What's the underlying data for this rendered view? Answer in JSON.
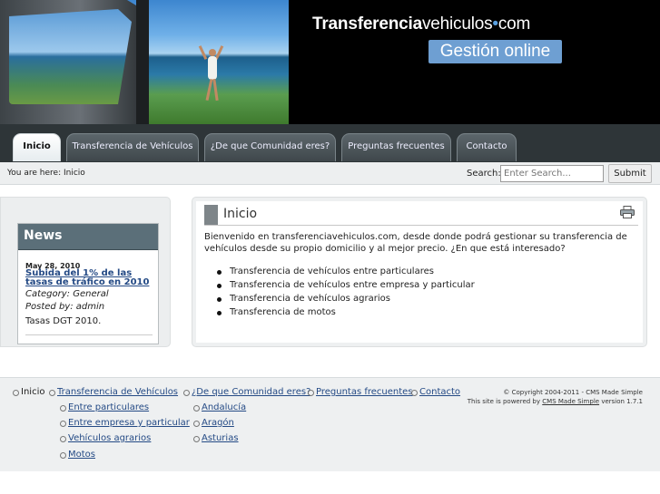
{
  "header": {
    "logo_bold": "Transferencia",
    "logo_rest": "vehiculos",
    "logo_dot": "•",
    "logo_tld": "com",
    "badge": "Gestión online"
  },
  "nav": {
    "tabs": [
      {
        "label": "Inicio",
        "active": true
      },
      {
        "label": "Transferencia de Vehículos",
        "active": false
      },
      {
        "label": "¿De que Comunidad eres?",
        "active": false
      },
      {
        "label": "Preguntas frecuentes",
        "active": false
      },
      {
        "label": "Contacto",
        "active": false
      }
    ]
  },
  "breadcrumb": {
    "prefix": "You are here:",
    "current": "Inicio"
  },
  "search": {
    "label": "Search:",
    "placeholder": "Enter Search...",
    "button": "Submit"
  },
  "news": {
    "title": "News",
    "date": "May 28, 2010",
    "headline": "Subida del 1% de las tasas de tráfico en 2010",
    "category": "Category: General",
    "posted_by": "Posted by: admin",
    "summary": "Tasas DGT 2010."
  },
  "main": {
    "title": "Inicio",
    "intro": "Bienvenido en transferenciavehiculos.com, desde donde podrá gestionar su transferencia de vehículos desde su propio domicilio y al mejor precio. ¿En que está interesado?",
    "bullets": [
      "Transferencia de vehículos entre particulares",
      "Transferencia de vehículos entre empresa y particular",
      "Transferencia de vehículos agrarios",
      "Transferencia de motos"
    ]
  },
  "footer": {
    "inicio": "Inicio",
    "transferencia": "Transferencia de Vehículos",
    "sub_transferencia": [
      "Entre particulares",
      "Entre empresa y particular",
      "Vehículos agrarios",
      "Motos"
    ],
    "comunidad": "¿De que Comunidad eres?",
    "sub_comunidad": [
      "Andalucía",
      "Aragón",
      "Asturias"
    ],
    "faq": "Preguntas frecuentes",
    "contacto": "Contacto",
    "copyright": "© Copyright 2004-2011 - CMS Made Simple",
    "powered_pre": "This site is powered by",
    "powered_link": "CMS Made Simple",
    "powered_post": "version 1.7.1"
  },
  "colors": {
    "nav_bg": "#2e3538",
    "badge_bg": "#6e9fd2",
    "link": "#244a85",
    "news_header": "#5b6f79"
  }
}
